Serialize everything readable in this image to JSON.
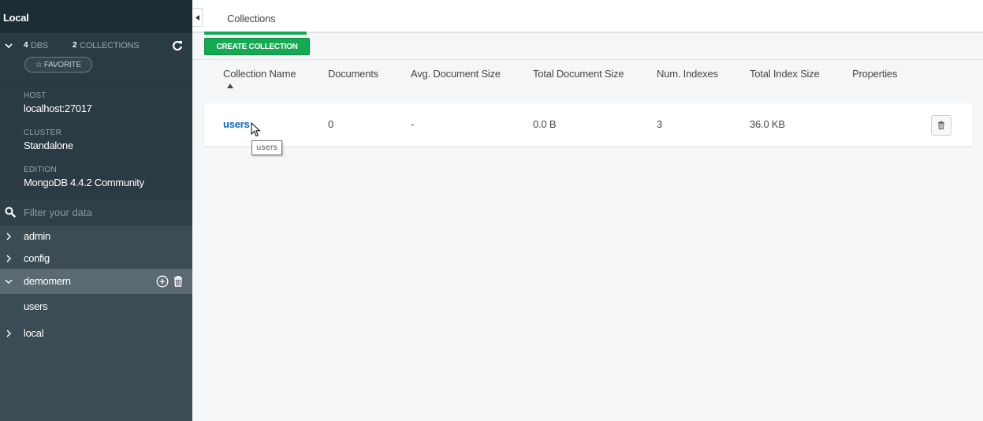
{
  "sidebar": {
    "title": "Local",
    "stats": {
      "dbs_count": "4",
      "dbs_label": "DBS",
      "collections_count": "2",
      "collections_label": "COLLECTIONS"
    },
    "favorite_label": "FAVORITE",
    "info": {
      "host_label": "HOST",
      "host_value": "localhost:27017",
      "cluster_label": "CLUSTER",
      "cluster_value": "Standalone",
      "edition_label": "EDITION",
      "edition_value": "MongoDB 4.4.2 Community"
    },
    "filter_placeholder": "Filter your data",
    "databases": [
      {
        "name": "admin",
        "expanded": false
      },
      {
        "name": "config",
        "expanded": false
      },
      {
        "name": "demomern",
        "expanded": true,
        "collections": [
          "users"
        ]
      },
      {
        "name": "local",
        "expanded": false
      }
    ]
  },
  "tabs": [
    {
      "label": "Collections",
      "active": true
    }
  ],
  "toolbar": {
    "create_label": "CREATE COLLECTION"
  },
  "table": {
    "columns": [
      "Collection Name",
      "Documents",
      "Avg. Document Size",
      "Total Document Size",
      "Num. Indexes",
      "Total Index Size",
      "Properties"
    ],
    "sorted_column": "Collection Name",
    "sort_direction": "ascending",
    "rows": [
      {
        "name": "users",
        "documents": "0",
        "avg_size": "-",
        "total_size": "0.0 B",
        "num_indexes": "3",
        "index_size": "36.0 KB",
        "properties": ""
      }
    ]
  },
  "tooltip": {
    "text": "users"
  },
  "colors": {
    "sidebar_bg": "#3c4c55",
    "sidebar_header_bg": "#1d2d36",
    "accent_green": "#13aa52",
    "link_blue": "#006cbc",
    "active_db_bg": "#5b6a72"
  },
  "icons": {
    "collapse": "caret-left-icon",
    "refresh": "refresh-icon",
    "favorite": "star-outline-icon",
    "search": "search-icon",
    "expand": "chevron-right-icon",
    "collapse_db": "chevron-down-icon",
    "add": "plus-circle-icon",
    "delete": "trash-icon",
    "sort": "sort-ascending-icon"
  }
}
